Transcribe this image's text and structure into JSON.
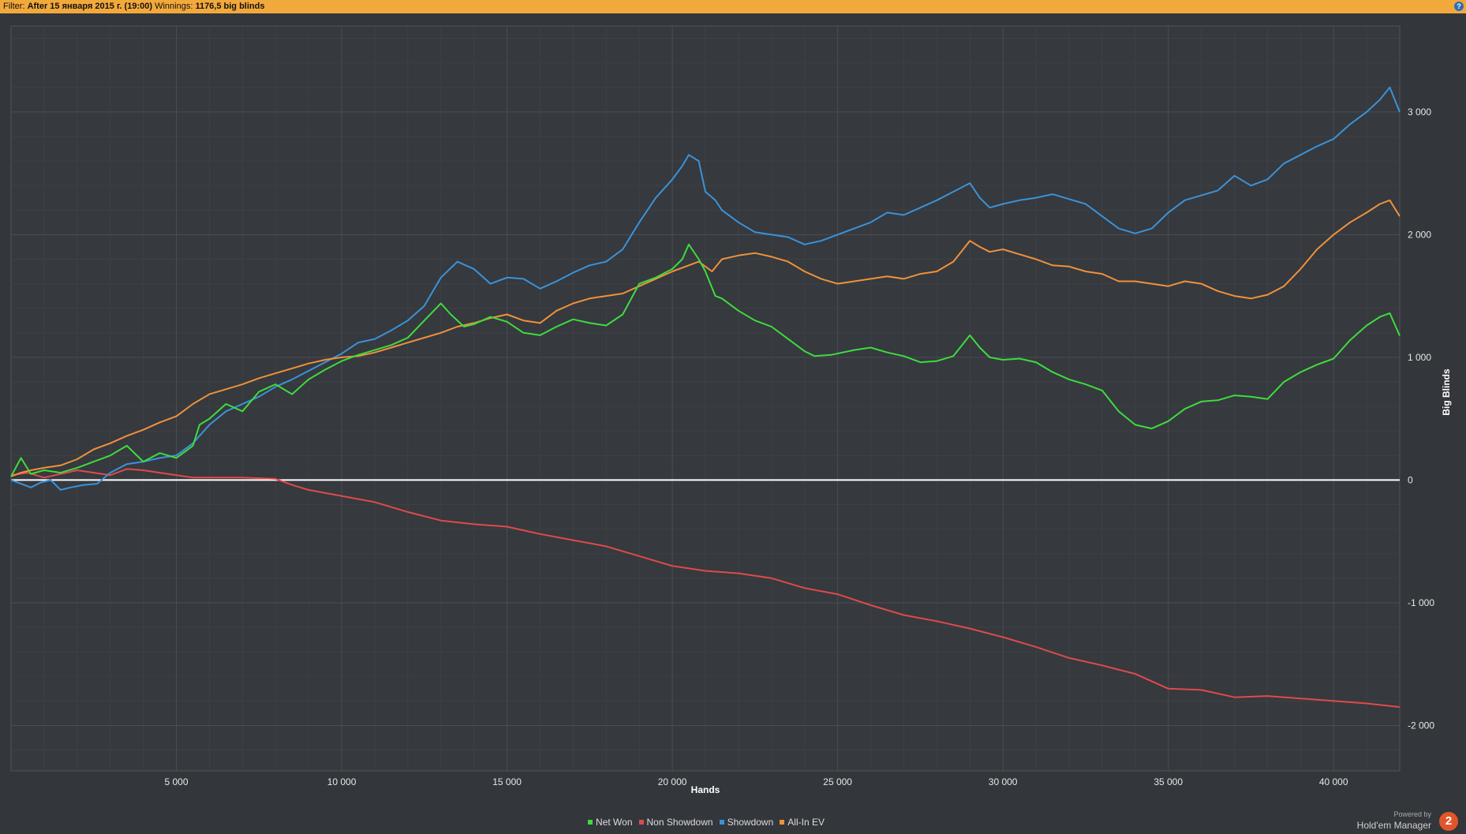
{
  "filter_bar": {
    "filter_label": "Filter:",
    "filter_value": "After 15 января 2015 г. (19:00)",
    "winnings_label": "Winnings:",
    "winnings_value": "1176,5 big blinds",
    "help_icon": "help-icon"
  },
  "branding": {
    "powered_by": "Powered by",
    "product": "Hold'em Manager",
    "logo_text": "2"
  },
  "colors": {
    "background": "#33363b",
    "grid": "#4a4e54",
    "zero_line": "#ffffff",
    "net_won": "#3ddc3d",
    "non_showdown": "#e04a4a",
    "showdown": "#3a93d8",
    "all_in_ev": "#f0913a",
    "filter_bar": "#f2a93b"
  },
  "chart_data": {
    "type": "line",
    "title": "",
    "xlabel": "Hands",
    "ylabel": "Big Blinds",
    "xlim": [
      0,
      42000
    ],
    "ylim": [
      -2370,
      3700
    ],
    "x_ticks": [
      5000,
      10000,
      15000,
      20000,
      25000,
      30000,
      35000,
      40000
    ],
    "x_tick_labels": [
      "5 000",
      "10 000",
      "15 000",
      "20 000",
      "25 000",
      "30 000",
      "35 000",
      "40 000"
    ],
    "y_ticks": [
      -2000,
      -1000,
      0,
      1000,
      2000,
      3000
    ],
    "y_tick_labels": [
      "-2 000",
      "-1 000",
      "0",
      "1 000",
      "2 000",
      "3 000"
    ],
    "grid": true,
    "legend_position": "bottom",
    "series": [
      {
        "name": "Net Won",
        "color": "#3ddc3d",
        "x": [
          0,
          300,
          600,
          1000,
          1500,
          2000,
          2500,
          3000,
          3500,
          4000,
          4500,
          5000,
          5500,
          5700,
          6000,
          6500,
          7000,
          7500,
          8000,
          8500,
          9000,
          9500,
          10000,
          10500,
          11000,
          11500,
          12000,
          12500,
          13000,
          13300,
          13700,
          14000,
          14500,
          15000,
          15500,
          16000,
          16500,
          17000,
          17500,
          18000,
          18500,
          19000,
          19500,
          20000,
          20300,
          20500,
          20800,
          21000,
          21300,
          21500,
          22000,
          22500,
          23000,
          23500,
          24000,
          24300,
          24800,
          25500,
          26000,
          26500,
          27000,
          27500,
          28000,
          28500,
          29000,
          29300,
          29600,
          30000,
          30500,
          31000,
          31500,
          32000,
          32500,
          33000,
          33500,
          34000,
          34500,
          35000,
          35500,
          36000,
          36500,
          37000,
          37500,
          38000,
          38500,
          39000,
          39500,
          40000,
          40500,
          41000,
          41400,
          41700,
          42000
        ],
        "y": [
          30,
          180,
          50,
          80,
          60,
          100,
          150,
          200,
          280,
          150,
          220,
          180,
          280,
          450,
          500,
          620,
          560,
          720,
          780,
          700,
          820,
          900,
          970,
          1020,
          1060,
          1100,
          1160,
          1300,
          1440,
          1350,
          1250,
          1270,
          1330,
          1290,
          1200,
          1180,
          1250,
          1310,
          1280,
          1260,
          1350,
          1600,
          1650,
          1720,
          1800,
          1920,
          1800,
          1700,
          1500,
          1480,
          1380,
          1300,
          1250,
          1150,
          1050,
          1010,
          1020,
          1060,
          1080,
          1040,
          1010,
          960,
          970,
          1010,
          1180,
          1080,
          1000,
          980,
          990,
          960,
          880,
          820,
          780,
          730,
          560,
          450,
          420,
          480,
          580,
          640,
          650,
          690,
          680,
          660,
          800,
          880,
          940,
          990,
          1140,
          1260,
          1330,
          1360,
          1176.5
        ]
      },
      {
        "name": "Non Showdown",
        "color": "#e04a4a",
        "x": [
          0,
          500,
          1000,
          1500,
          2000,
          2500,
          3000,
          3500,
          4000,
          4500,
          5000,
          5500,
          6000,
          7000,
          8000,
          8500,
          9000,
          10000,
          11000,
          12000,
          13000,
          14000,
          15000,
          16000,
          17000,
          18000,
          19000,
          20000,
          21000,
          22000,
          23000,
          24000,
          25000,
          26000,
          27000,
          28000,
          29000,
          30000,
          31000,
          32000,
          33000,
          34000,
          35000,
          36000,
          37000,
          38000,
          39000,
          40000,
          41000,
          42000
        ],
        "y": [
          40,
          60,
          20,
          50,
          80,
          60,
          40,
          90,
          80,
          60,
          40,
          20,
          20,
          20,
          10,
          -40,
          -80,
          -130,
          -180,
          -260,
          -330,
          -360,
          -380,
          -440,
          -490,
          -540,
          -620,
          -700,
          -740,
          -760,
          -800,
          -880,
          -930,
          -1020,
          -1100,
          -1150,
          -1210,
          -1280,
          -1360,
          -1450,
          -1510,
          -1580,
          -1700,
          -1710,
          -1770,
          -1760,
          -1780,
          -1800,
          -1820,
          -1850
        ]
      },
      {
        "name": "Showdown",
        "color": "#3a93d8",
        "x": [
          0,
          300,
          600,
          900,
          1200,
          1500,
          1800,
          2200,
          2600,
          3000,
          3500,
          4000,
          4500,
          5000,
          5500,
          6000,
          6500,
          7000,
          7500,
          8000,
          8500,
          9000,
          9500,
          10000,
          10500,
          11000,
          11500,
          12000,
          12500,
          13000,
          13500,
          14000,
          14500,
          15000,
          15500,
          16000,
          16500,
          17000,
          17500,
          18000,
          18500,
          19000,
          19500,
          20000,
          20300,
          20500,
          20800,
          21000,
          21300,
          21500,
          22000,
          22500,
          23000,
          23500,
          24000,
          24500,
          25000,
          25500,
          26000,
          26500,
          27000,
          27500,
          28000,
          28500,
          29000,
          29300,
          29600,
          30000,
          30500,
          31000,
          31500,
          32000,
          32500,
          33000,
          33500,
          34000,
          34500,
          35000,
          35500,
          36000,
          36500,
          37000,
          37500,
          38000,
          38500,
          39000,
          39500,
          40000,
          40500,
          41000,
          41400,
          41700,
          42000
        ],
        "y": [
          0,
          -30,
          -60,
          -20,
          0,
          -80,
          -60,
          -40,
          -30,
          60,
          130,
          150,
          180,
          200,
          300,
          450,
          560,
          620,
          680,
          760,
          820,
          890,
          960,
          1030,
          1120,
          1150,
          1220,
          1300,
          1420,
          1650,
          1780,
          1720,
          1600,
          1650,
          1640,
          1560,
          1620,
          1690,
          1750,
          1780,
          1880,
          2100,
          2300,
          2450,
          2560,
          2650,
          2600,
          2350,
          2280,
          2200,
          2100,
          2020,
          2000,
          1980,
          1920,
          1950,
          2000,
          2050,
          2100,
          2180,
          2160,
          2220,
          2280,
          2350,
          2420,
          2300,
          2220,
          2250,
          2280,
          2300,
          2330,
          2290,
          2250,
          2150,
          2050,
          2010,
          2050,
          2180,
          2280,
          2320,
          2360,
          2480,
          2400,
          2450,
          2580,
          2650,
          2720,
          2780,
          2900,
          3000,
          3100,
          3200,
          3000
        ]
      },
      {
        "name": "All-In EV",
        "color": "#f0913a",
        "x": [
          0,
          300,
          600,
          1000,
          1500,
          2000,
          2500,
          3000,
          3500,
          4000,
          4500,
          5000,
          5500,
          6000,
          6500,
          7000,
          7500,
          8000,
          8500,
          9000,
          9500,
          10000,
          10500,
          11000,
          11500,
          12000,
          12500,
          13000,
          13500,
          14000,
          14500,
          15000,
          15500,
          16000,
          16500,
          17000,
          17500,
          18000,
          18500,
          19000,
          19500,
          20000,
          20500,
          20800,
          21200,
          21500,
          22000,
          22500,
          23000,
          23500,
          24000,
          24500,
          25000,
          25500,
          26000,
          26500,
          27000,
          27500,
          28000,
          28500,
          29000,
          29300,
          29600,
          30000,
          30500,
          31000,
          31500,
          32000,
          32500,
          33000,
          33500,
          34000,
          34500,
          35000,
          35500,
          36000,
          36500,
          37000,
          37500,
          38000,
          38500,
          39000,
          39500,
          40000,
          40500,
          41000,
          41400,
          41700,
          42000
        ],
        "y": [
          30,
          60,
          80,
          100,
          120,
          170,
          250,
          300,
          360,
          410,
          470,
          520,
          620,
          700,
          740,
          780,
          830,
          870,
          910,
          950,
          980,
          1000,
          1010,
          1040,
          1080,
          1120,
          1160,
          1200,
          1250,
          1280,
          1320,
          1350,
          1300,
          1280,
          1380,
          1440,
          1480,
          1500,
          1520,
          1580,
          1640,
          1700,
          1750,
          1780,
          1700,
          1800,
          1830,
          1850,
          1820,
          1780,
          1700,
          1640,
          1600,
          1620,
          1640,
          1660,
          1640,
          1680,
          1700,
          1780,
          1950,
          1900,
          1860,
          1880,
          1840,
          1800,
          1750,
          1740,
          1700,
          1680,
          1620,
          1620,
          1600,
          1580,
          1620,
          1600,
          1540,
          1500,
          1480,
          1510,
          1580,
          1720,
          1880,
          2000,
          2100,
          2180,
          2250,
          2280,
          2150
        ]
      }
    ]
  }
}
